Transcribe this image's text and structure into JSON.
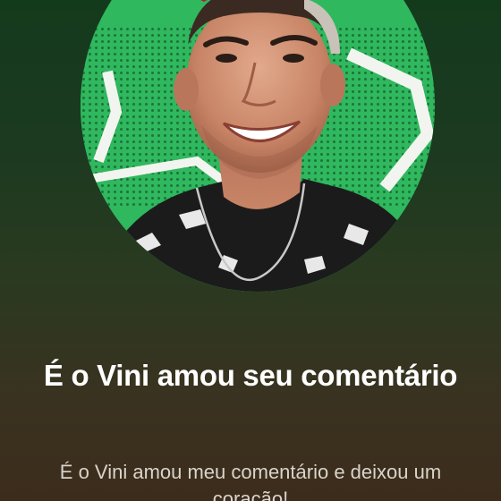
{
  "notification": {
    "title": "É o Vini amou seu comentário",
    "message": "É o Vini amou meu comentário e deixou um coração!"
  },
  "icons": {
    "reaction": "heart-icon"
  },
  "colors": {
    "background_top": "#143a1c",
    "background_bottom": "#3c2c1c",
    "avatar_background": "#2fb85e",
    "heart": "#e8355e",
    "title_text": "#ffffff",
    "message_text": "#d9d4cc"
  }
}
